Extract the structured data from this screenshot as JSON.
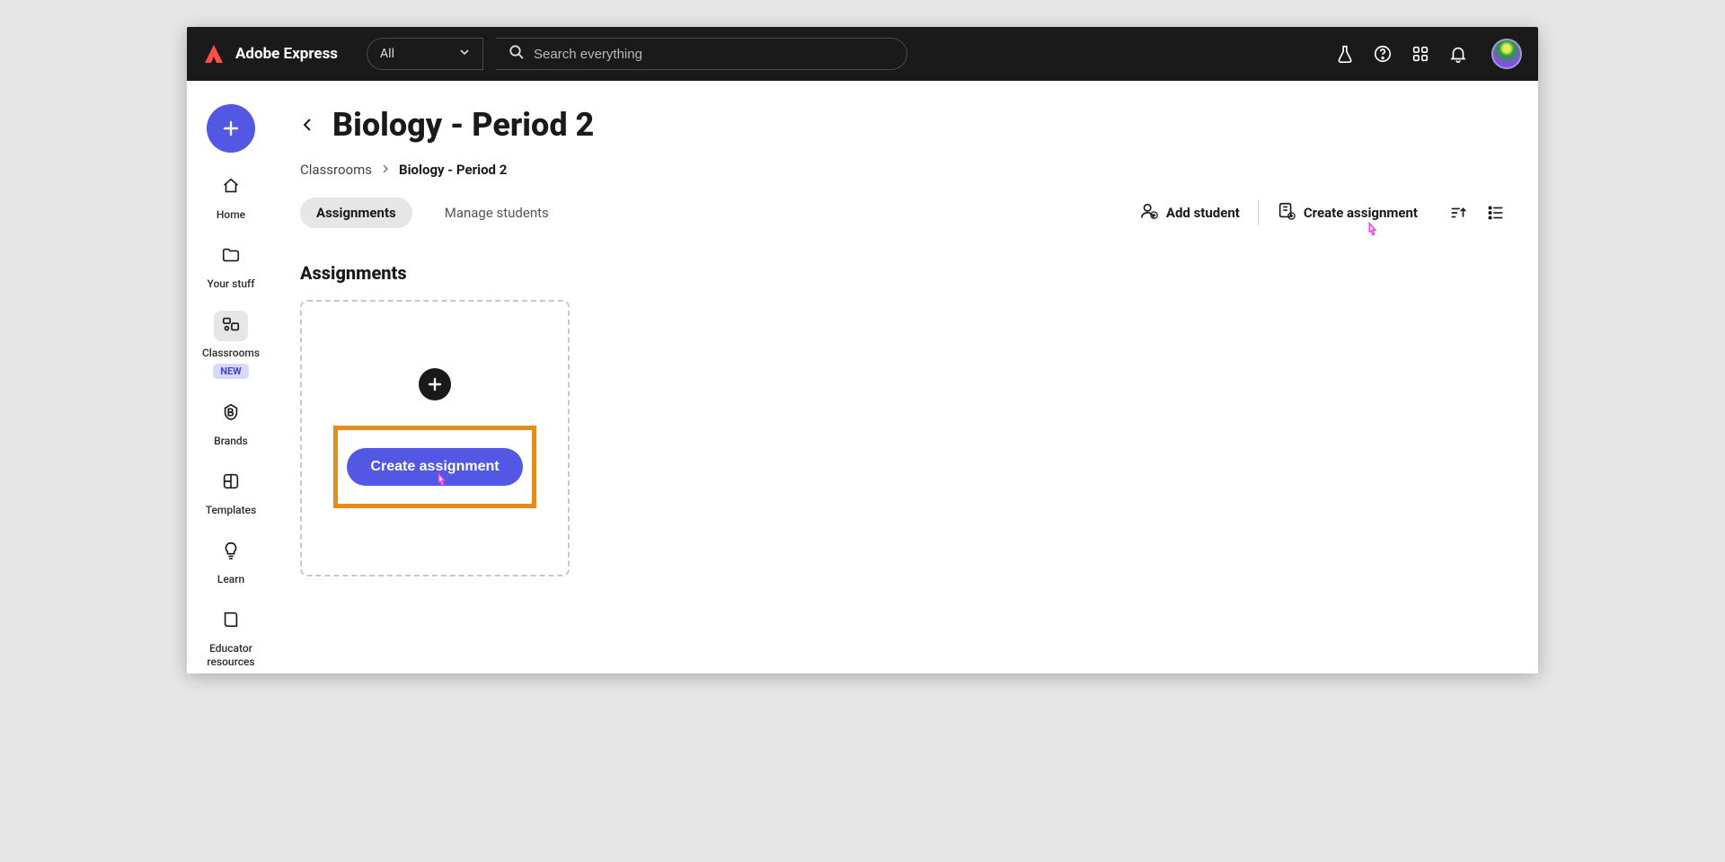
{
  "header": {
    "product": "Adobe Express",
    "filter_label": "All",
    "search_placeholder": "Search everything"
  },
  "sidebar": {
    "items": [
      {
        "label": "Home"
      },
      {
        "label": "Your stuff"
      },
      {
        "label": "Classrooms",
        "badge": "NEW"
      },
      {
        "label": "Brands"
      },
      {
        "label": "Templates"
      },
      {
        "label": "Learn"
      },
      {
        "label": "Educator resources"
      }
    ]
  },
  "main": {
    "title": "Biology - Period 2",
    "breadcrumbs": {
      "root": "Classrooms",
      "current": "Biology - Period 2"
    },
    "tabs": {
      "assignments": "Assignments",
      "manage": "Manage students"
    },
    "actions": {
      "add_student": "Add student",
      "create_assignment": "Create assignment"
    },
    "section_heading": "Assignments",
    "card": {
      "button_label": "Create assignment"
    }
  }
}
